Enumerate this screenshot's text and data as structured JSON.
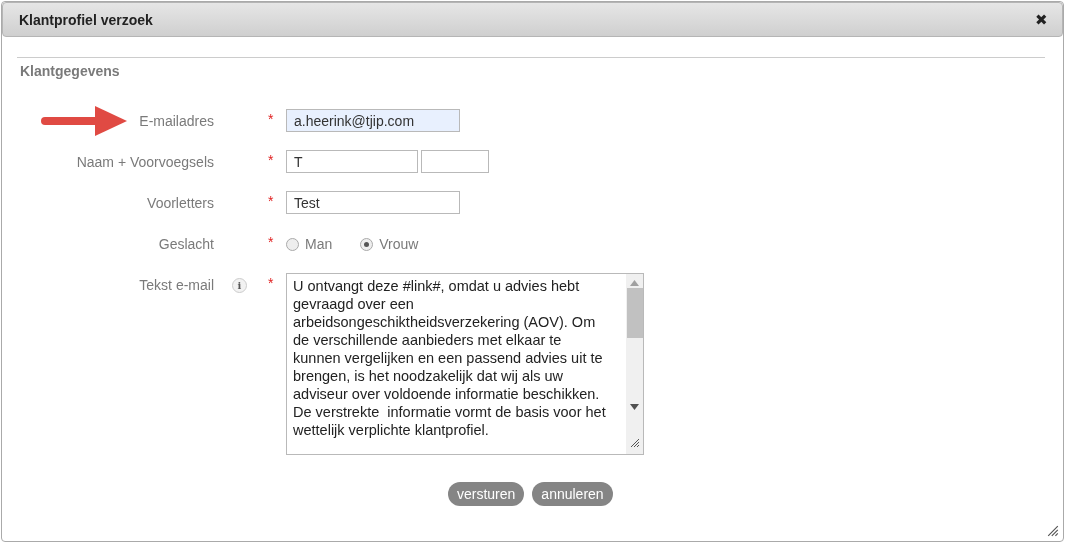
{
  "dialog": {
    "title": "Klantprofiel verzoek",
    "close": "✖"
  },
  "section": {
    "title": "Klantgegevens"
  },
  "fields": [
    {
      "kind": "text",
      "label": "E-mailadres",
      "required": true,
      "pointed": true,
      "inputs": [
        {
          "value": "a.heerink@tjip.com",
          "highlighted": true
        }
      ]
    },
    {
      "kind": "text",
      "label": "Naam + Voorvoegsels",
      "required": true,
      "inputs": [
        {
          "value": "T",
          "highlighted": false
        },
        {
          "highlighted": false
        }
      ]
    },
    {
      "kind": "text",
      "label": "Voorletters",
      "required": true,
      "inputs": [
        {
          "value": "Test",
          "highlighted": false
        }
      ]
    },
    {
      "kind": "radio",
      "label": "Geslacht",
      "required": true,
      "options": [
        {
          "label": "Man",
          "selected": false
        },
        {
          "label": "Vrouw",
          "selected": true
        }
      ]
    },
    {
      "kind": "textarea",
      "label": "Tekst e-mail",
      "required": true,
      "info": "i",
      "value": "U ontvangt deze #link#, omdat u advies hebt gevraagd over een arbeidsongeschiktheidsverzekering (AOV). Om de verschillende aanbieders met elkaar te kunnen vergelijken en een passend advies uit te brengen, is het noodzakelijk dat wij als uw adviseur over voldoende informatie beschikken. De verstrekte  informatie vormt de basis voor het wettelijk verplichte klantprofiel."
    }
  ],
  "buttons": [
    "versturen",
    "annuleren"
  ],
  "required_mark": "*"
}
